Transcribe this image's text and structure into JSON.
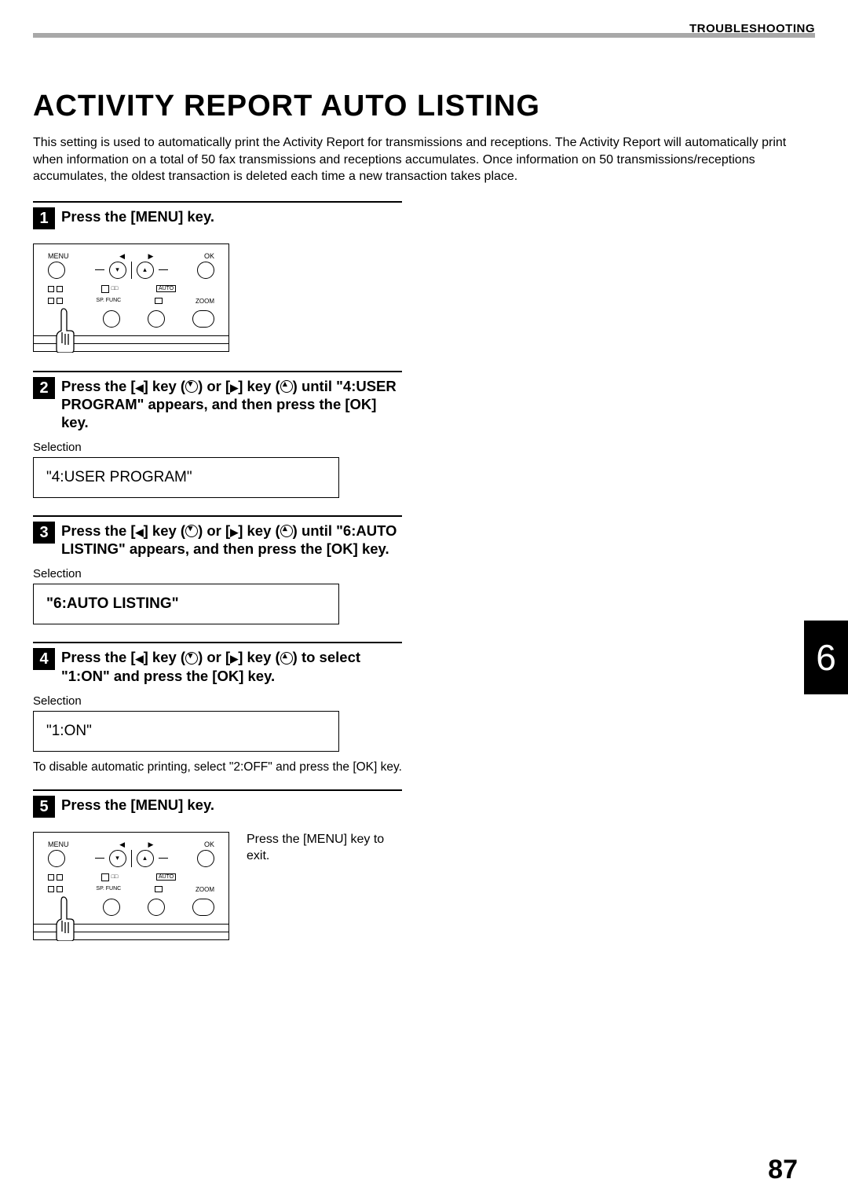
{
  "header": {
    "section": "TROUBLESHOOTING"
  },
  "title": "ACTIVITY REPORT AUTO LISTING",
  "intro": "This setting is used to automatically print the Activity Report for transmissions and receptions. The Activity Report will automatically print when information on a total of 50 fax transmissions and receptions accumulates. Once information on 50 transmissions/receptions accumulates, the oldest transaction is deleted each time a new transaction takes place.",
  "steps": {
    "s1": {
      "num": "1",
      "text_a": "Press the [MENU] key."
    },
    "s2": {
      "num": "2",
      "text_a": "Press the [",
      "text_b": "] key (",
      "text_c": ") or [",
      "text_d": "] key (",
      "text_e": ") until \"4:USER PROGRAM\" appears, and then press the [OK] key.",
      "selection_label": "Selection",
      "lcd": "\"4:USER PROGRAM\""
    },
    "s3": {
      "num": "3",
      "text_a": "Press the [",
      "text_b": "] key (",
      "text_c": ") or [",
      "text_d": "] key (",
      "text_e": ") until \"6:AUTO LISTING\" appears, and then press the [OK] key.",
      "selection_label": "Selection",
      "lcd": "\"6:AUTO LISTING\""
    },
    "s4": {
      "num": "4",
      "text_a": "Press the [",
      "text_b": "] key (",
      "text_c": ") or [",
      "text_d": "] key (",
      "text_e": ") to select \"1:ON\" and press the [OK] key.",
      "selection_label": "Selection",
      "lcd": "\"1:ON\"",
      "note": "To disable automatic printing, select \"2:OFF\" and press the [OK] key."
    },
    "s5": {
      "num": "5",
      "text_a": "Press the [MENU] key.",
      "note": "Press the [MENU] key to exit."
    }
  },
  "panel": {
    "menu": "MENU",
    "ok": "OK",
    "auto": "AUTO",
    "spfunc": "SP. FUNC",
    "zoom": "ZOOM"
  },
  "chapter_tab": "6",
  "page_number": "87"
}
